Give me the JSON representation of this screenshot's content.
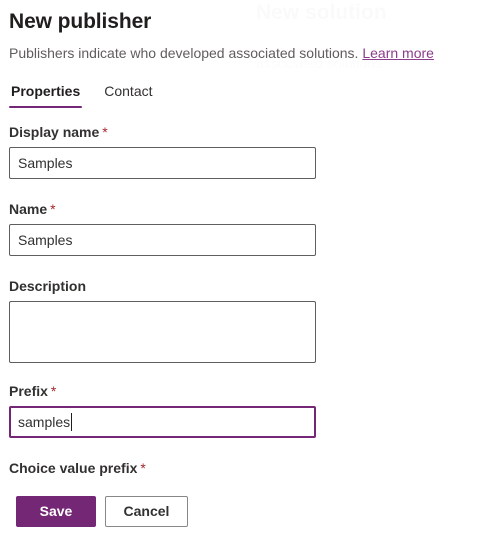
{
  "colors": {
    "accent_purple": "#742774",
    "link_purple": "#8c3c8c",
    "required_red": "#a4262c",
    "label_gray": "#323130",
    "subtitle_gray": "#605e5c",
    "border_gray": "#605e5c"
  },
  "header": {
    "title": "New publisher",
    "subtitle": "Publishers indicate who developed associated solutions.",
    "learn_more_label": "Learn more"
  },
  "ghost": {
    "title": "New solution",
    "subtitle": "associated solutions."
  },
  "tabs": [
    {
      "label": "Properties",
      "active": true
    },
    {
      "label": "Contact",
      "active": false
    }
  ],
  "fields": {
    "display_name": {
      "label": "Display name",
      "required_mark": "*",
      "value": "Samples",
      "placeholder": ""
    },
    "name": {
      "label": "Name",
      "required_mark": "*",
      "value": "Samples",
      "placeholder": ""
    },
    "description": {
      "label": "Description",
      "value": "",
      "placeholder": ""
    },
    "prefix": {
      "label": "Prefix",
      "required_mark": "*",
      "value": "samples",
      "placeholder": "",
      "focused": true
    },
    "choice_value_prefix": {
      "label": "Choice value prefix",
      "required_mark": "*"
    }
  },
  "footer": {
    "save_label": "Save",
    "cancel_label": "Cancel"
  }
}
